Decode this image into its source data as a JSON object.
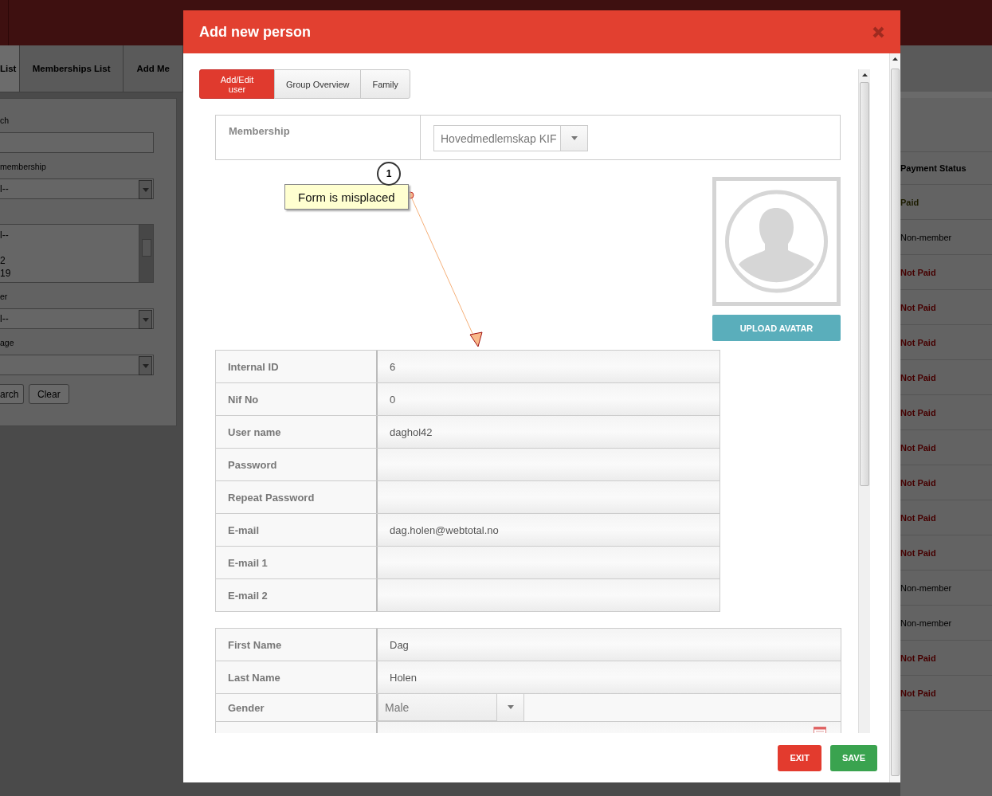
{
  "background": {
    "tabs": [
      {
        "label": "List",
        "selected": true
      },
      {
        "label": "Memberships List",
        "selected": false
      },
      {
        "label": "Add Me",
        "selected": false
      }
    ],
    "filters": [
      {
        "kind": "input",
        "label": "ch"
      },
      {
        "kind": "select",
        "label": "membership",
        "value": "l--"
      },
      {
        "kind": "listbox",
        "options": [
          "l--",
          "2",
          "19"
        ]
      },
      {
        "kind": "select",
        "label": "er",
        "value": "l--"
      },
      {
        "kind": "select",
        "label": "age"
      }
    ],
    "buttons": [
      "arch",
      "Clear"
    ],
    "table": {
      "column": "Payment Status",
      "rows": [
        {
          "status": "Paid",
          "kind": "paid"
        },
        {
          "status": "Non-member",
          "kind": "none"
        },
        {
          "status": "Not Paid",
          "kind": "unpaid"
        },
        {
          "status": "Not Paid",
          "kind": "unpaid"
        },
        {
          "status": "Not Paid",
          "kind": "unpaid"
        },
        {
          "status": "Not Paid",
          "kind": "unpaid"
        },
        {
          "status": "Not Paid",
          "kind": "unpaid"
        },
        {
          "status": "Not Paid",
          "kind": "unpaid"
        },
        {
          "status": "Not Paid",
          "kind": "unpaid"
        },
        {
          "status": "Not Paid",
          "kind": "unpaid"
        },
        {
          "status": "Not Paid",
          "kind": "unpaid"
        },
        {
          "status": "Non-member",
          "kind": "none"
        },
        {
          "status": "Non-member",
          "kind": "none"
        },
        {
          "status": "Not Paid",
          "kind": "unpaid"
        },
        {
          "status": "Not Paid",
          "kind": "unpaid"
        }
      ]
    }
  },
  "modal": {
    "title": "Add new person",
    "tabs": [
      {
        "label": "Add/Edit user",
        "selected": true
      },
      {
        "label": "Group Overview",
        "selected": false
      },
      {
        "label": "Family",
        "selected": false
      }
    ],
    "membership": {
      "label": "Membership",
      "value": "Hovedmedlemskap KIF"
    },
    "annotation": {
      "number": "1",
      "text": "Form is misplaced"
    },
    "upload_button": "UPLOAD AVATAR",
    "account_fields": [
      {
        "label": "Internal ID",
        "value": "6"
      },
      {
        "label": "Nif No",
        "value": "0"
      },
      {
        "label": "User name",
        "value": "daghol42"
      },
      {
        "label": "Password"
      },
      {
        "label": "Repeat Password"
      },
      {
        "label": "E-mail",
        "value": "dag.holen@webtotal.no"
      },
      {
        "label": "E-mail 1"
      },
      {
        "label": "E-mail 2"
      }
    ],
    "personal_fields": [
      {
        "kind": "text",
        "label": "First Name",
        "value": "Dag"
      },
      {
        "kind": "text",
        "label": "Last Name",
        "value": "Holen"
      },
      {
        "kind": "select",
        "label": "Gender",
        "value": "Male"
      },
      {
        "kind": "date"
      }
    ],
    "buttons": [
      {
        "label": "EXIT",
        "kind": "danger"
      },
      {
        "label": "SAVE",
        "kind": "success"
      }
    ]
  }
}
